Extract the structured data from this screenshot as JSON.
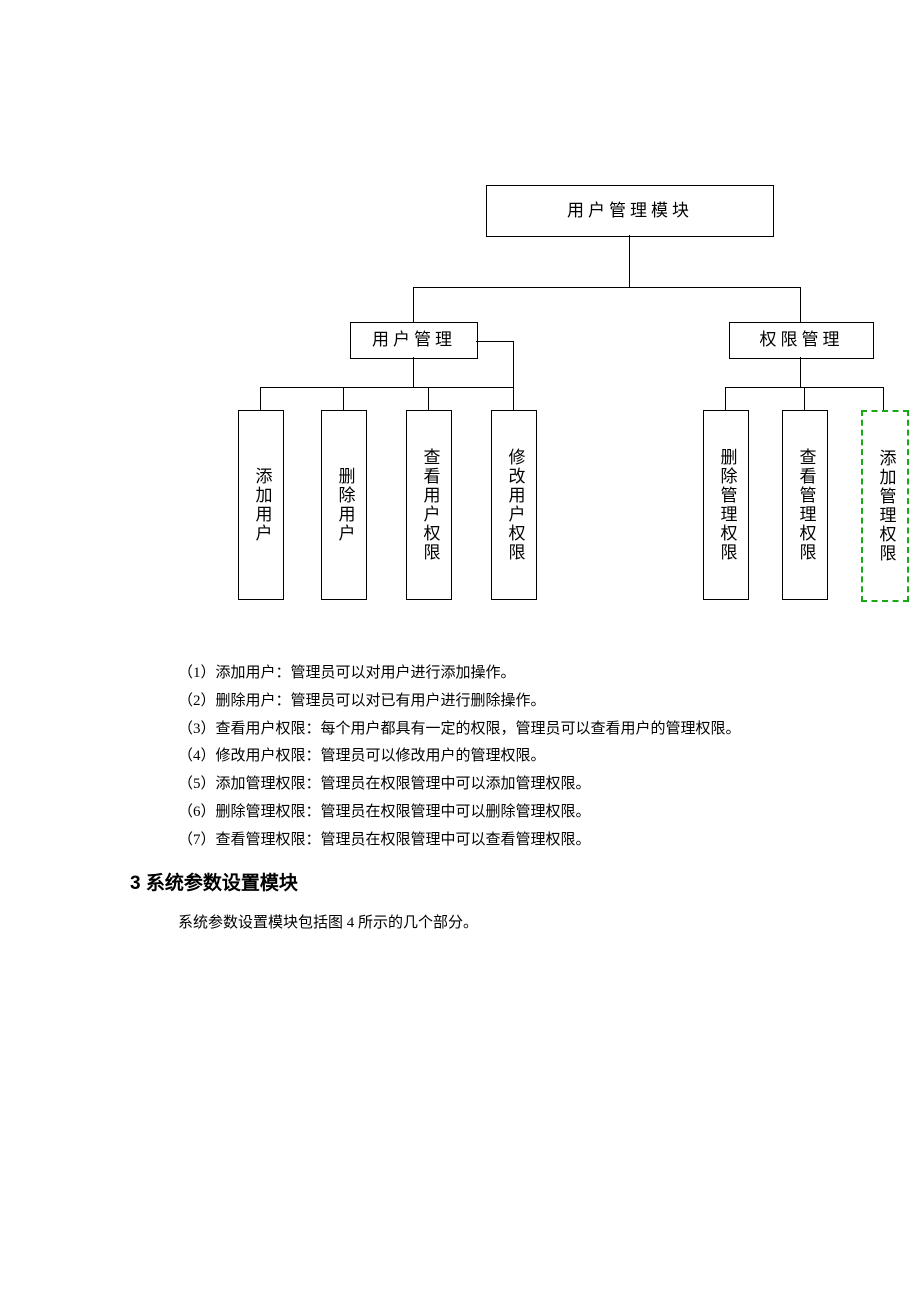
{
  "diagram": {
    "root": "用户管理模块",
    "mid_left": "用户管理",
    "mid_right": "权限管理",
    "leaves": {
      "l1": "添加用户",
      "l2": "删除用户",
      "l3": "查看用户权限",
      "l4": "修改用户权限",
      "l5": "删除管理权限",
      "l6": "查看管理权限",
      "l7": "添加管理权限"
    }
  },
  "desc": {
    "d1": "（1）添加用户：管理员可以对用户进行添加操作。",
    "d2": "（2）删除用户：管理员可以对已有用户进行删除操作。",
    "d3": "（3）查看用户权限：每个用户都具有一定的权限，管理员可以查看用户的管理权限。",
    "d4": "（4）修改用户权限：管理员可以修改用户的管理权限。",
    "d5": "（5）添加管理权限：管理员在权限管理中可以添加管理权限。",
    "d6": "（6）删除管理权限：管理员在权限管理中可以删除管理权限。",
    "d7": "（7）查看管理权限：管理员在权限管理中可以查看管理权限。"
  },
  "section3_heading": "3 系统参数设置模块",
  "section3_text": "系统参数设置模块包括图 4 所示的几个部分。"
}
